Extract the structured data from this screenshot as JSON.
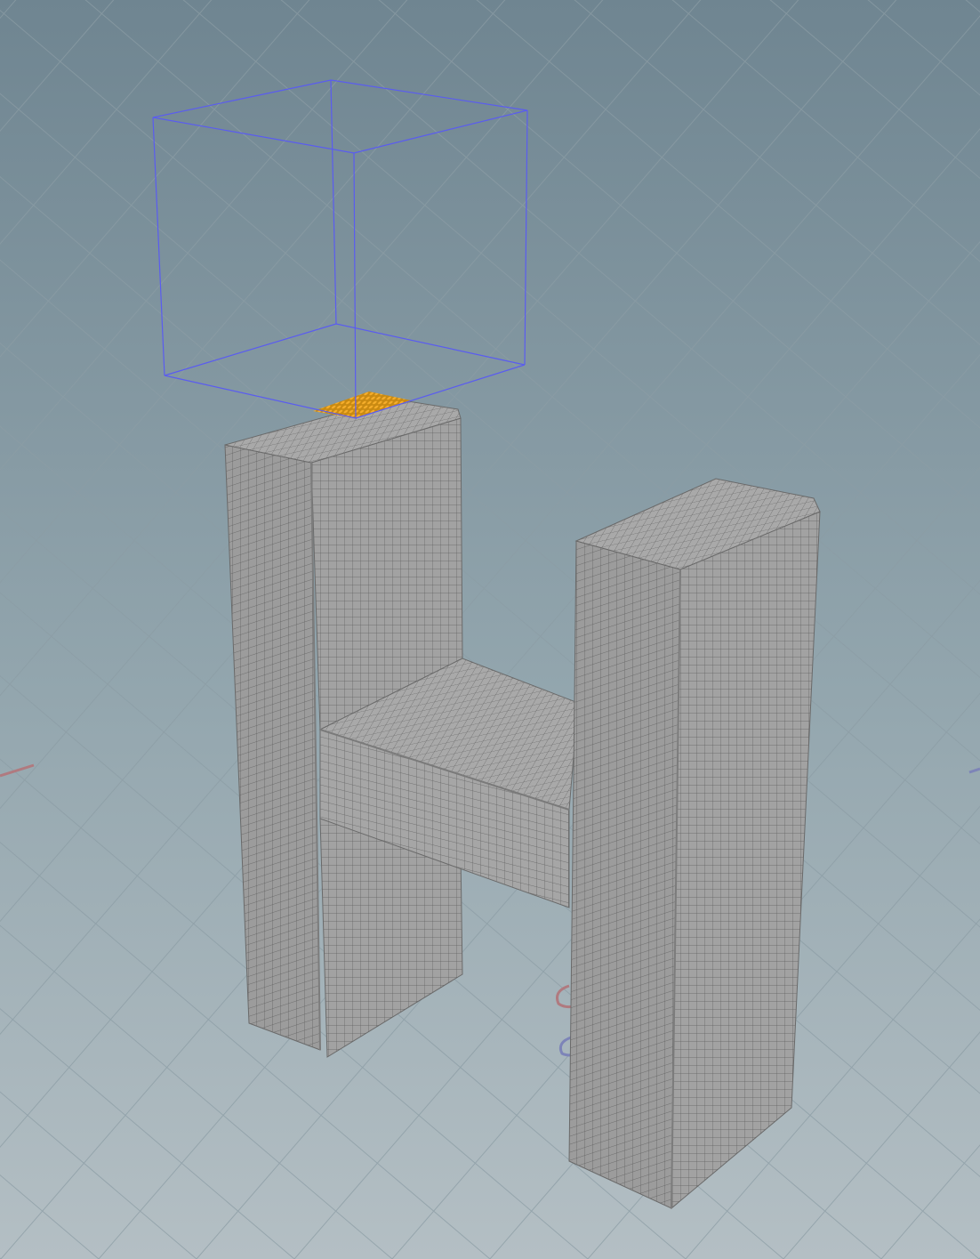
{
  "viewport": {
    "background_top": "#6f8591",
    "background_bottom": "#b3bec3",
    "grid_color": "#8e9ea6",
    "axis_x_color": "#b07a7f",
    "axis_z_color": "#7d84b8"
  },
  "scene": {
    "object": "letter-H-mesh",
    "mesh_face_light": "#a3a3a3",
    "mesh_face_mid": "#9a9a9a",
    "mesh_face_dark": "#8f8f8f",
    "mesh_wire_color": "#5e5e5e",
    "selection_points_color": "#f0a21c",
    "bounding_box_color": "#5a5cf0"
  }
}
